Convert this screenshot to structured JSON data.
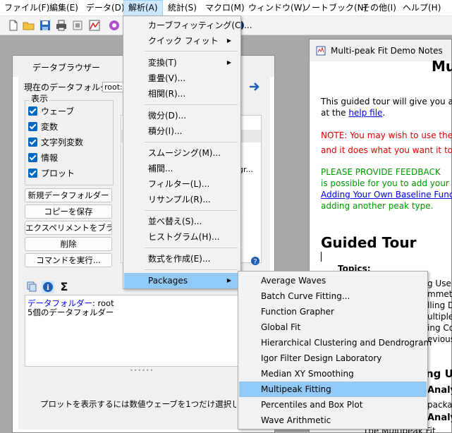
{
  "menubar": {
    "items": [
      "ファイル(F)",
      "編集(E)",
      "データ(D)",
      "解析(A)",
      "統計(S)",
      "マクロ(M)",
      "ウィンドウ(W)",
      "ノートブック(N)",
      "その他(I)",
      "ヘルプ(H)"
    ]
  },
  "analysis_menu": {
    "items": [
      "カーブフィッティング(C)...",
      "クイック フィット",
      "変換(T)",
      "重畳(V)...",
      "相関(R)...",
      "微分(D)...",
      "積分(I)...",
      "スムージング(M)...",
      "補間...",
      "フィルター(L)...",
      "リサンプル(R)...",
      "並べ替え(S)...",
      "ヒストグラム(H)...",
      "数式を作成(E)...",
      "Packages"
    ]
  },
  "packages_submenu": {
    "items": [
      "Average Waves",
      "Batch Curve Fitting...",
      "Function Grapher",
      "Global Fit",
      "Hierarchical Clustering and Dendrogram",
      "Igor Filter Design Laboratory",
      "Median XY Smoothing",
      "Multipeak Fitting",
      "Percentiles and Box Plot",
      "Wave Arithmetic"
    ],
    "highlighted": "Multipeak Fitting"
  },
  "data_browser": {
    "title": "データブラウザー",
    "current_folder_label": "現在のデータフォルダー:",
    "current_folder_value": "root:",
    "show_group_title": "表示",
    "checkboxes": [
      "ウェーブ",
      "変数",
      "文字列変数",
      "情報",
      "プロット"
    ],
    "buttons": [
      "新規データフォルダー",
      "コピーを保存",
      "エクスペリメントをブラウズ...",
      "削除",
      "コマンドを実行..."
    ],
    "info_link": "データフォルダー",
    "info_value": ": root",
    "info_line2": "5個のデータフォルダー",
    "list_partial": "gr...",
    "hint": "プロットを表示するには数値ウェーブを1つだけ選択してください"
  },
  "notes": {
    "title": "Multi-peak Fit Demo Notes",
    "heading_partial": "Mul",
    "p1a": "This guided tour will give you an",
    "p1b": "at the ",
    "p1_link": "help file",
    "p1_tail": ".",
    "note_a": "NOTE: You may wish to use the",
    "note_b": "and it does what you want it to d",
    "fb_a": "PLEASE PROVIDE FEEDBACK",
    "fb_b": "is possible for you to add your ov",
    "fb_link": "Adding Your Own Baseline Func",
    "fb_d": "adding another peak type.",
    "guided_tour": "Guided Tour",
    "topics": "Topics:",
    "frag_lines": [
      "g Use",
      "mmetric",
      "lling D",
      "ultiple",
      "ing Com",
      "evious"
    ],
    "using_partial": "ng Us",
    "analy1": "Analy",
    "packag": "packag",
    "analy2": "Analy",
    "bottom_partial": "The Multipeak Fit"
  }
}
